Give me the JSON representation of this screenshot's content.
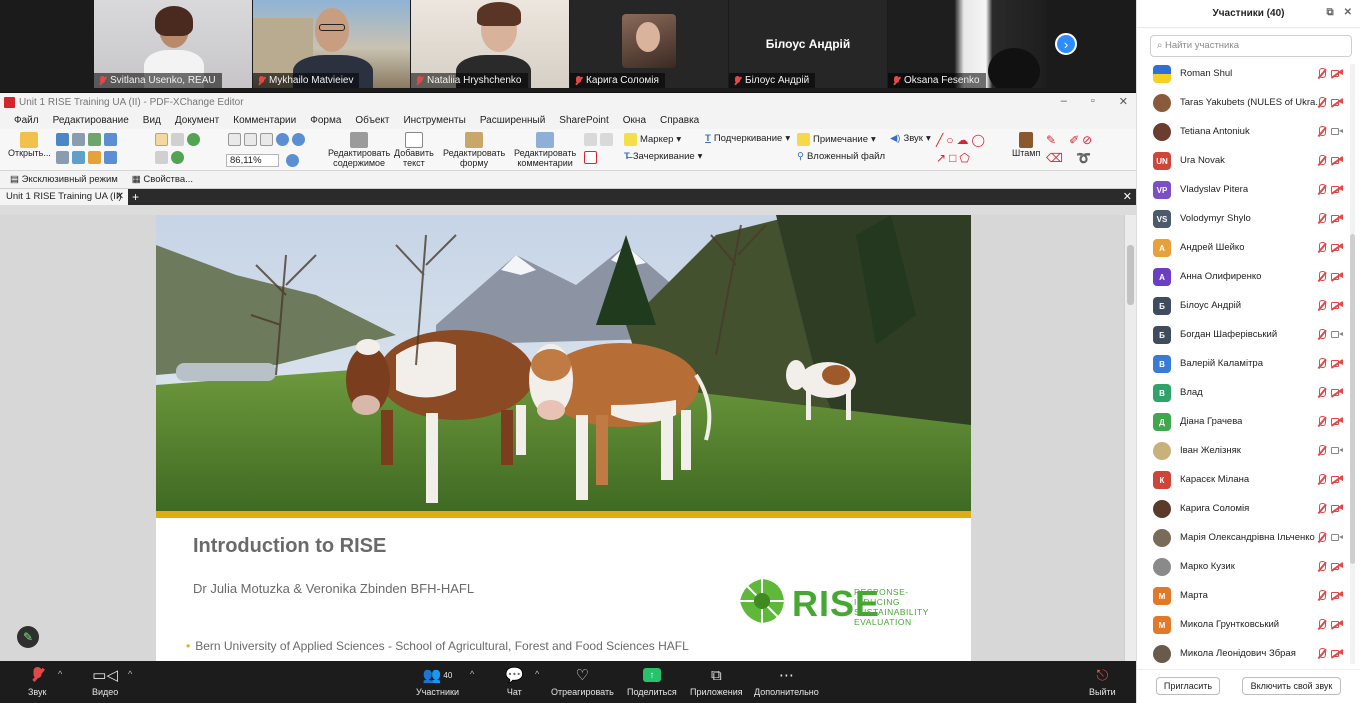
{
  "video_tiles": [
    {
      "name": "Svitlana Usenko, REAU",
      "muted": true
    },
    {
      "name": "Mykhailo Matvieiev",
      "muted": true
    },
    {
      "name": "Nataliia Hryshchenko",
      "muted": true
    },
    {
      "name": "Карига Соломія",
      "muted": true
    },
    {
      "name": "Білоус Андрій",
      "muted": true,
      "center_label": "Білоус Андрій"
    },
    {
      "name": "Oksana Fesenko",
      "muted": true
    }
  ],
  "pdf": {
    "title": "Unit 1 RISE Training UA (II) - PDF-XChange Editor",
    "menu": [
      "Файл",
      "Редактирование",
      "Вид",
      "Документ",
      "Комментарии",
      "Форма",
      "Объект",
      "Инструменты",
      "Расширенный",
      "SharePoint",
      "Окна",
      "Справка"
    ],
    "ribbon": {
      "open": "Открыть...",
      "zoom": "86,11%",
      "edit_content": [
        "Редактировать",
        "содержимое"
      ],
      "add_text": [
        "Добавить",
        "текст"
      ],
      "edit_form": [
        "Редактировать",
        "форму"
      ],
      "edit_comments": [
        "Редактировать",
        "комментарии"
      ],
      "marker": "Маркер",
      "strikeout": "Зачеркивание",
      "underline": "Подчеркивание",
      "note": "Примечание",
      "attachment": "Вложенный файл",
      "sound": "Звук",
      "stamp": "Штамп"
    },
    "toolbar2": [
      "Эксклюзивный режим",
      "Свойства..."
    ],
    "tab": "Unit 1 RISE Training UA (II)",
    "slide": {
      "title": "Introduction to RISE",
      "authors": "Dr Julia Motuzka & Veronika Zbinden BFH-HAFL",
      "institution": "Bern University of Applied Sciences -  School of Agricultural, Forest and Food Sciences HAFL",
      "logo_word": "RISE",
      "logo_tagline": [
        "RESPONSE-INDUCING",
        "SUSTAINABILITY",
        "EVALUATION"
      ]
    }
  },
  "zoom_bar": {
    "audio": "Звук",
    "video": "Видео",
    "participants": "Участники",
    "participants_count": "40",
    "chat": "Чат",
    "react": "Отреагировать",
    "share": "Поделиться",
    "apps": "Приложения",
    "more": "Дополнительно",
    "leave": "Выйти"
  },
  "panel": {
    "title": "Участники (40)",
    "search_placeholder": "Найти участника",
    "invite": "Пригласить",
    "unmute": "Включить свой звук",
    "participants": [
      {
        "initials": "",
        "name": "Roman Shul",
        "color": "#2f6fd6",
        "flag": true,
        "video": false
      },
      {
        "initials": "",
        "name": "Taras Yakubets (NULES of Ukra...",
        "color": "#8a5a3c",
        "video": false
      },
      {
        "initials": "",
        "name": "Tetiana Antoniuk",
        "color": "#6b3d2e",
        "video": true
      },
      {
        "initials": "UN",
        "name": "Ura Novak",
        "color": "#d0453a",
        "video": false
      },
      {
        "initials": "VP",
        "name": "Vladyslav Pitera",
        "color": "#7a4fc7",
        "video": false
      },
      {
        "initials": "VS",
        "name": "Volodymyr Shylo",
        "color": "#4c5a6e",
        "video": false
      },
      {
        "initials": "А",
        "name": "Андрей Шейко",
        "color": "#e8a03a",
        "video": false
      },
      {
        "initials": "А",
        "name": "Анна Олифиренко",
        "color": "#6a3fc4",
        "video": false
      },
      {
        "initials": "Б",
        "name": "Білоус Андрій",
        "color": "#3f4c5e",
        "video": false
      },
      {
        "initials": "Б",
        "name": "Богдан Шаферівський",
        "color": "#3f4c5e",
        "video": true
      },
      {
        "initials": "В",
        "name": "Валерій Каламітра",
        "color": "#3a7bd5",
        "video": false
      },
      {
        "initials": "В",
        "name": "Влад",
        "color": "#2fa36a",
        "video": false
      },
      {
        "initials": "Д",
        "name": "Діана Грачева",
        "color": "#3fa84c",
        "video": false
      },
      {
        "initials": "",
        "name": "Іван Желізняк",
        "color": "#c9b27a",
        "video": true
      },
      {
        "initials": "К",
        "name": "Карасєк Мілана",
        "color": "#d0453a",
        "video": false
      },
      {
        "initials": "",
        "name": "Карига Соломія",
        "color": "#5a3a2a",
        "video": false
      },
      {
        "initials": "",
        "name": "Марія Олександрівна Ільченко",
        "color": "#7a6a5a",
        "video": true
      },
      {
        "initials": "",
        "name": "Марко Кузик",
        "color": "#8a8a8a",
        "video": false
      },
      {
        "initials": "М",
        "name": "Марта",
        "color": "#e07a2a",
        "video": false
      },
      {
        "initials": "М",
        "name": "Микола Грунтковський",
        "color": "#e07a2a",
        "video": false
      },
      {
        "initials": "",
        "name": "Микола Леонідович Збрая",
        "color": "#6a5a4a",
        "video": false
      }
    ]
  },
  "colors": {
    "accent": "#2d8cff",
    "muted_red": "#e34848",
    "rise_green": "#46a832",
    "gold": "#e0ac16",
    "share_green": "#26c36a"
  }
}
